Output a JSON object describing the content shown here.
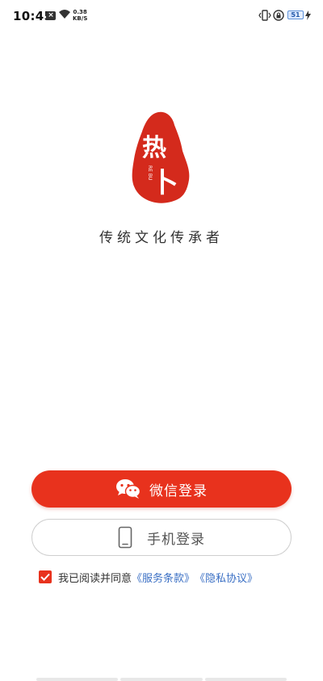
{
  "status_bar": {
    "time": "10:45",
    "speed_value": "0.38",
    "speed_unit": "KB/S",
    "battery": "51",
    "icons": [
      "notification-x-icon",
      "wifi-icon",
      "vibrate-icon",
      "rotation-lock-icon",
      "battery-icon",
      "charging-icon"
    ]
  },
  "logo": {
    "char_top": "热",
    "char_bottom": "卜",
    "small_text": "RE BU",
    "color": "#d42a1c"
  },
  "slogan": "传统文化传承者",
  "buttons": {
    "wechat_label": "微信登录",
    "phone_label": "手机登录"
  },
  "agreement": {
    "checked": true,
    "prefix": "我已阅读并同意",
    "terms": "《服务条款》",
    "privacy": "《隐私协议》"
  },
  "colors": {
    "accent": "#e8321d",
    "link": "#3a6fc4"
  }
}
